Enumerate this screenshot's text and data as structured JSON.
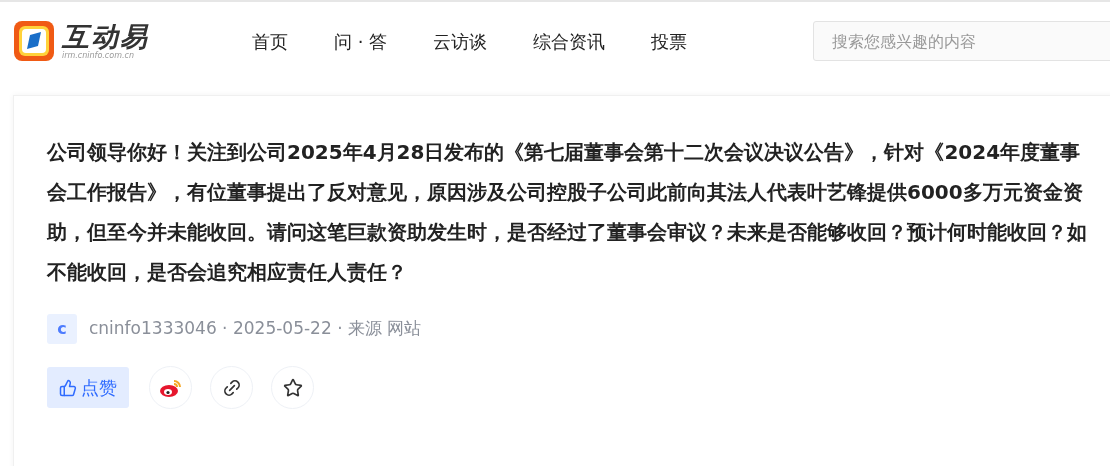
{
  "header": {
    "logo": {
      "title": "互动易",
      "subtitle": "irm.cninfo.com.cn"
    },
    "nav": [
      {
        "label": "首页",
        "selected": false
      },
      {
        "label": "问 · 答",
        "selected": false
      },
      {
        "label": "云访谈",
        "selected": false
      },
      {
        "label": "综合资讯",
        "selected": false
      },
      {
        "label": "投票",
        "selected": false
      }
    ],
    "search": {
      "placeholder": "搜索您感兴趣的内容"
    }
  },
  "question": {
    "text": "公司领导你好！关注到公司2025年4月28日发布的《第七届董事会第十二次会议决议公告》，针对《2024年度董事会工作报告》，有位董事提出了反对意见，原因涉及公司控股子公司此前向其法人代表叶艺锋提供6000多万元资金资助，但至今并未能收回。请问这笔巨款资助发生时，是否经过了董事会审议？未来是否能够收回？预计何时能收回？如不能收回，是否会追究相应责任人责任？",
    "avatar": "c",
    "meta": "cninfo1333046 · 2025-05-22 · 来源 网站",
    "like_label": "点赞"
  }
}
